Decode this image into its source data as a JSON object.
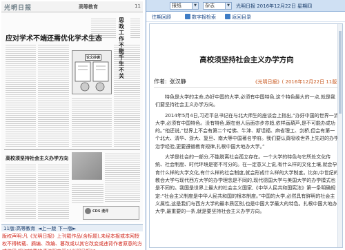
{
  "left": {
    "masthead": "光明日报",
    "section_tag": "高等教育",
    "page_number": "11",
    "scan": {
      "big_title": "应对学术不端还需优化学术生态",
      "side_title": "思政工作不能千生不关",
      "cartoon_label": "论文抄袭",
      "mid_title": "高校须坚持社会主义办学方向",
      "ad_text": "CDS 漫评"
    },
    "page_nav": {
      "current": "11版:高等教育",
      "prev": "◄上一版",
      "next": "下一版►"
    },
    "notice": "版权声明:凡《光明日报》上刊载作品(含标题),未经本报或本网授权不得转载、摘编、改编、篡改或以其它改变或违背作者原意的方式使用,授权转载的请注明来源“《光明日报》”。"
  },
  "right": {
    "topbar": {
      "paper_select": "报纸",
      "type_select": "杂志",
      "issue_label": "光明日报 2016年12月22日 星期四"
    },
    "nav": {
      "past": "往期回顾",
      "digital": "数字报检索",
      "home": "返回目录"
    },
    "article": {
      "title": "高校须坚持社会主义办学方向",
      "source": "《光明日报》( 2016年12月22日 11版)",
      "author_label": "作者:",
      "author_name": "张汉静",
      "paragraphs": [
        "特色是大学的主命,办好中国的大学,必须有中国特色,这个特色最大的一点,就是我们要坚持社会主义办学方向。",
        "2014年5月4日,习近平总书记在与北大师生的座谈会上指出,“办好中国的世界一流大学,必须有中国特色。没有特色,跟在他人后面亦步亦趋,依样画葫芦,是不可能办成功的。”他还说,“世界上不会有第二个哈佛、牛津、斯坦福、麻省理工、剑桥,但会有第一个北大、清华、浙大、复旦、南大等中国著名学府。我们要认真吸收世界上先进的办学治学经验,更要遵循教育规律,扎根中国大地办大学。”",
        "大学是社会的一部分,不能脱离社会孤立存在。一个大学的特色与它所处文化传统、社会制度、时代环境是密不可分的。在一定意义上说,有什么样的文化土壤,就会孕育什么样的大学文化,有什么样的社会制度,就会形成什么样的大学制度。比如,中世纪的教会大学与现代西方大学的办学理念是不同的,现代德国大学与美国大学的办学模式也是不同的。我国是世界上最大的社会主义国家,《中华人民共和国宪法》第一条明确规定:“社会主义制度是中华人民共和国的根本制度。”中国的大学,必然具有鲜明的社会主义属性,这是我们与西方大学的最本质区别,也是中国大学最大的特色。扎根中国大地办大学,最重要的一条,就是要坚持社会主义办学方向。"
      ]
    }
  }
}
